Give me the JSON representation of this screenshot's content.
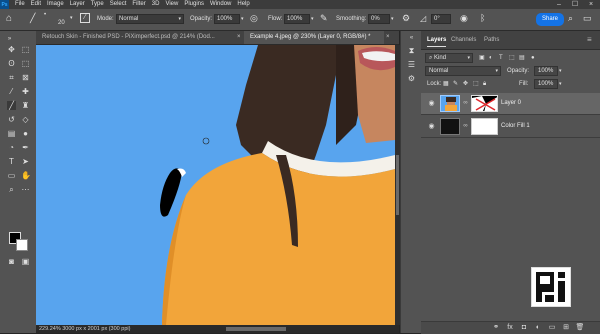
{
  "app": {
    "menu": [
      "File",
      "Edit",
      "Image",
      "Layer",
      "Type",
      "Select",
      "Filter",
      "3D",
      "View",
      "Plugins",
      "Window",
      "Help"
    ],
    "window_controls": [
      "minimize",
      "maximize",
      "close"
    ]
  },
  "options_bar": {
    "brush_size": "20",
    "mode_label": "Mode:",
    "mode_value": "Normal",
    "opacity_label": "Opacity:",
    "opacity_value": "100%",
    "flow_label": "Flow:",
    "flow_value": "100%",
    "smoothing_label": "Smoothing:",
    "smoothing_value": "0%",
    "angle_value": "0°",
    "share_label": "Share"
  },
  "document_tabs": [
    {
      "label": "Retouch Skin - Finished PSD - PiXimperfect.psd @ 214% (Dod...",
      "close": "×",
      "active": false
    },
    {
      "label": "Example 4.jpeg @ 230% (Layer 0, RGB/8#) *",
      "close": "×",
      "active": true
    }
  ],
  "status_bar": {
    "text": "229.24%  3000 px x 2001 px (300 ppi)"
  },
  "layers_panel": {
    "tabs": [
      {
        "label": "Layers",
        "active": true
      },
      {
        "label": "Channels",
        "active": false
      },
      {
        "label": "Paths",
        "active": false
      }
    ],
    "filter_kind": "Kind",
    "blend_mode": "Normal",
    "opacity_label": "Opacity:",
    "opacity_value": "100%",
    "lock_label": "Lock:",
    "fill_label": "Fill:",
    "fill_value": "100%",
    "layers": [
      {
        "name": "Layer 0",
        "selected": true
      },
      {
        "name": "Color Fill 1",
        "selected": false
      }
    ]
  },
  "colors": {
    "accent": "#1473e6",
    "canvas_bg": "#58a4ee",
    "sweater": "#f2a53a",
    "panel_bg": "#535353"
  }
}
